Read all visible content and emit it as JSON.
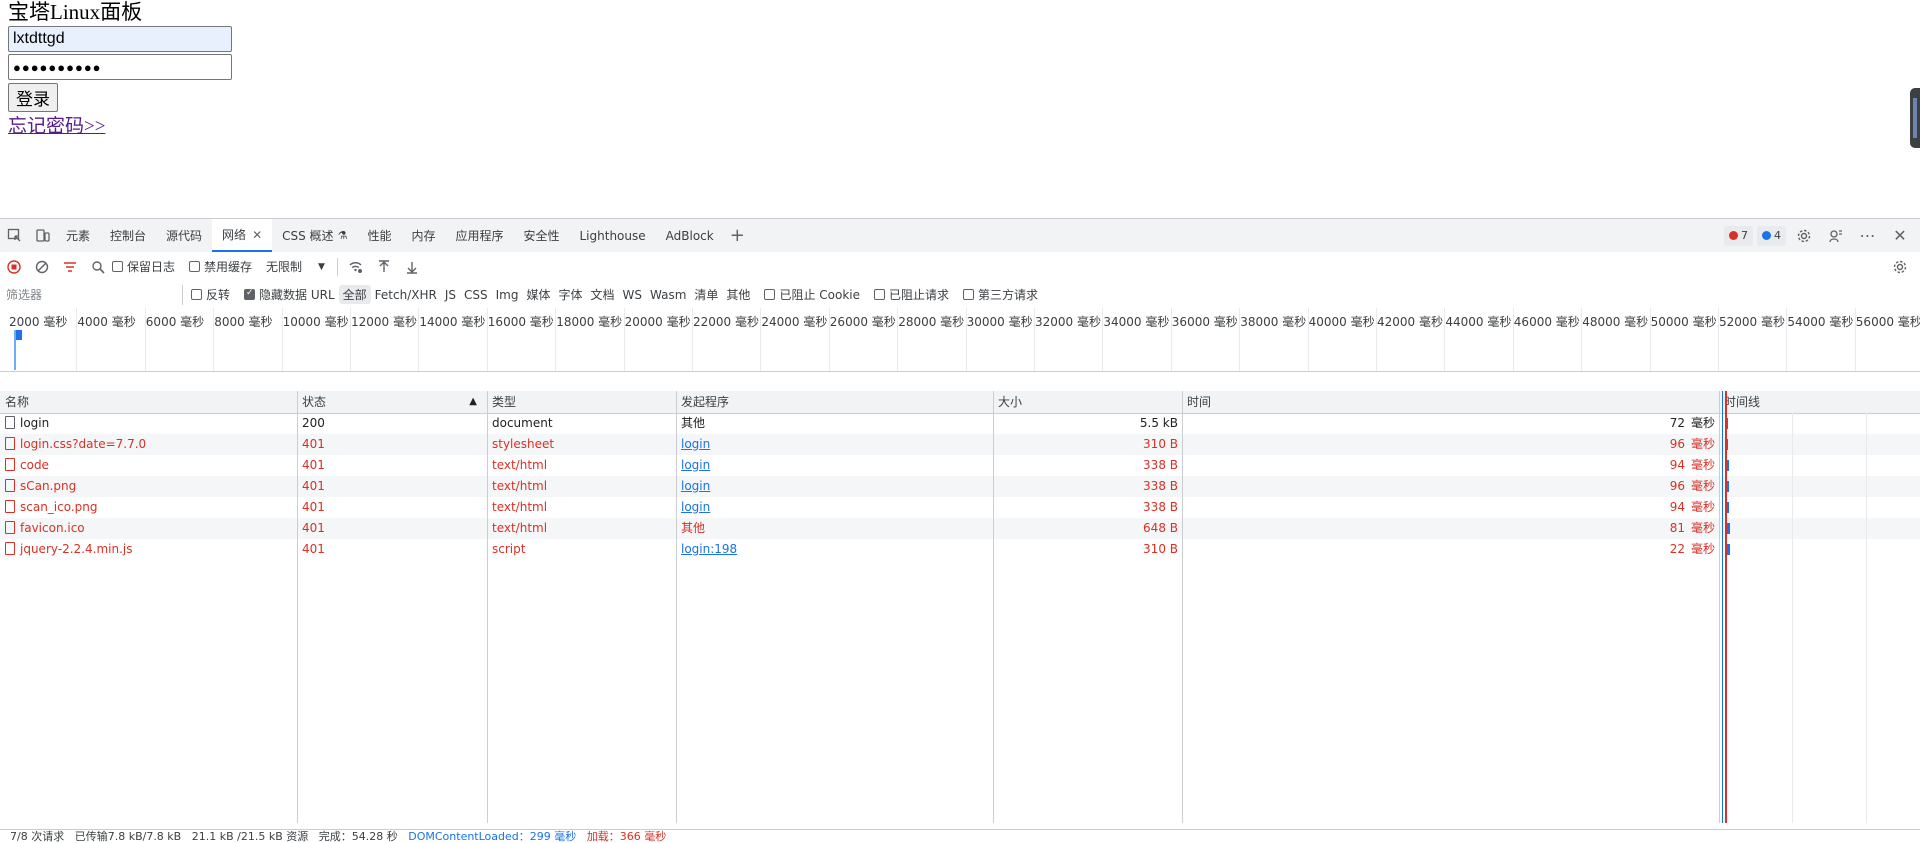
{
  "page": {
    "title": "宝塔Linux面板",
    "username_value": "lxtdttgd",
    "password_mask": "●●●●●●●●●●",
    "login_button": "登录",
    "forgot_link": "忘记密码>>"
  },
  "devtools": {
    "tabs": [
      {
        "label": "元素"
      },
      {
        "label": "控制台"
      },
      {
        "label": "源代码"
      },
      {
        "label": "网络",
        "active": true
      },
      {
        "label": "CSS 概述"
      },
      {
        "label": "性能"
      },
      {
        "label": "内存"
      },
      {
        "label": "应用程序"
      },
      {
        "label": "安全性"
      },
      {
        "label": "Lighthouse"
      },
      {
        "label": "AdBlock"
      }
    ],
    "errors_count": "7",
    "info_count": "4",
    "toolbar": {
      "preserve_log": "保留日志",
      "disable_cache": "禁用缓存",
      "throttle": "无限制"
    },
    "filter": {
      "placeholder": "筛选器",
      "invert": "反转",
      "hide_data_url": "隐藏数据 URL",
      "types": [
        "全部",
        "Fetch/XHR",
        "JS",
        "CSS",
        "Img",
        "媒体",
        "字体",
        "文档",
        "WS",
        "Wasm",
        "清单",
        "其他"
      ],
      "blocked_cookies": "已阻止 Cookie",
      "blocked_requests": "已阻止请求",
      "third_party": "第三方请求"
    },
    "overview_ticks": [
      "2000 毫秒",
      "4000 毫秒",
      "6000 毫秒",
      "8000 毫秒",
      "10000 毫秒",
      "12000 毫秒",
      "14000 毫秒",
      "16000 毫秒",
      "18000 毫秒",
      "20000 毫秒",
      "22000 毫秒",
      "24000 毫秒",
      "26000 毫秒",
      "28000 毫秒",
      "30000 毫秒",
      "32000 毫秒",
      "34000 毫秒",
      "36000 毫秒",
      "38000 毫秒",
      "40000 毫秒",
      "42000 毫秒",
      "44000 毫秒",
      "46000 毫秒",
      "48000 毫秒",
      "50000 毫秒",
      "52000 毫秒",
      "54000 毫秒",
      "56000 毫秒"
    ],
    "columns": {
      "name": "名称",
      "status": "状态",
      "type": "类型",
      "initiator": "发起程序",
      "size": "大小",
      "time": "时间",
      "waterfall": "时间线"
    },
    "time_unit": "毫秒",
    "requests": [
      {
        "name": "login",
        "status": "200",
        "type": "document",
        "initiator": "其他",
        "initiator_link": false,
        "size": "5.5 kB",
        "time": "72",
        "error": false
      },
      {
        "name": "login.css?date=7.7.0",
        "status": "401",
        "type": "stylesheet",
        "initiator": "login",
        "initiator_link": true,
        "size": "310 B",
        "time": "96",
        "error": true
      },
      {
        "name": "code",
        "status": "401",
        "type": "text/html",
        "initiator": "login",
        "initiator_link": true,
        "size": "338 B",
        "time": "94",
        "error": true
      },
      {
        "name": "sCan.png",
        "status": "401",
        "type": "text/html",
        "initiator": "login",
        "initiator_link": true,
        "size": "338 B",
        "time": "96",
        "error": true
      },
      {
        "name": "scan_ico.png",
        "status": "401",
        "type": "text/html",
        "initiator": "login",
        "initiator_link": true,
        "size": "338 B",
        "time": "94",
        "error": true
      },
      {
        "name": "favicon.ico",
        "status": "401",
        "type": "text/html",
        "initiator": "其他",
        "initiator_link": false,
        "size": "648 B",
        "time": "81",
        "error": true
      },
      {
        "name": "jquery-2.2.4.min.js",
        "status": "401",
        "type": "script",
        "initiator": "login:198",
        "initiator_link": true,
        "size": "310 B",
        "time": "22",
        "error": true
      }
    ],
    "status_bar": {
      "requests": "7/8 次请求",
      "transferred": "已传输7.8 kB/7.8 kB",
      "resources": "21.1 kB /21.5 kB 资源",
      "finish": "完成：54.28 秒",
      "dcl": "DOMContentLoaded：299 毫秒",
      "load": "加载：366 毫秒"
    },
    "colors": {
      "error": "#d93025",
      "accent": "#1a73e8"
    }
  }
}
